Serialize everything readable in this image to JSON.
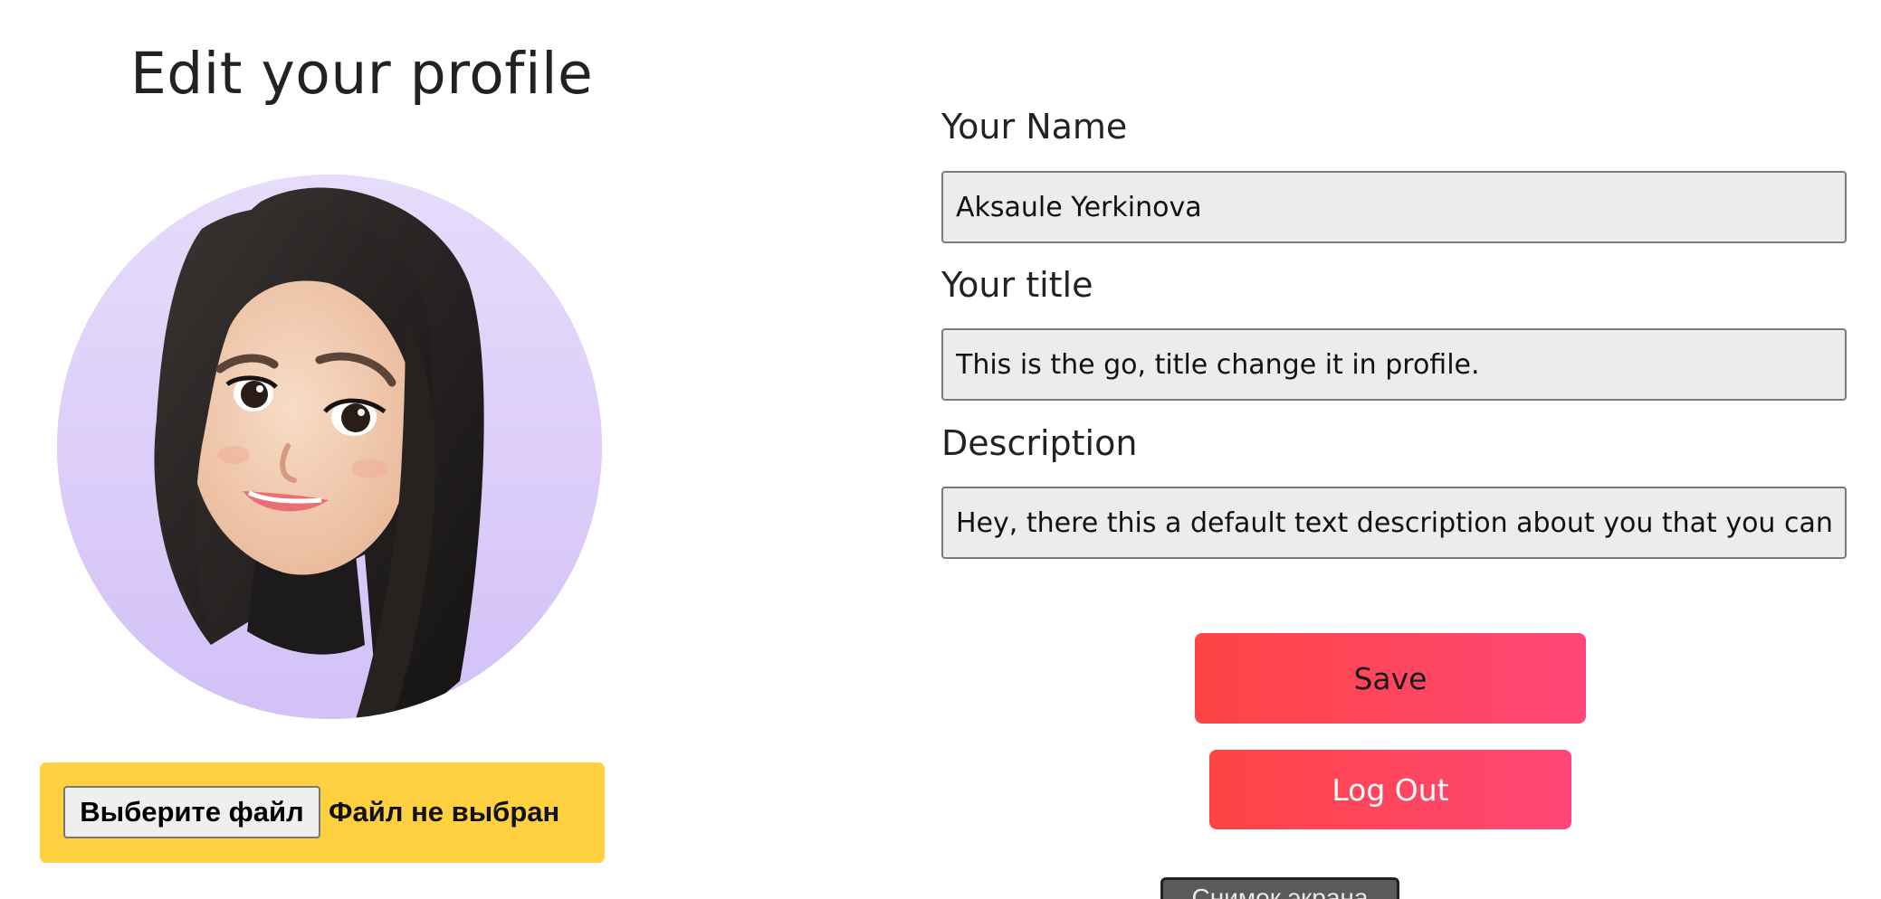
{
  "header": {
    "title": "Edit your profile"
  },
  "avatar": {
    "icon": "memoji-avatar",
    "background_color": "#d8c6f8"
  },
  "file_upload": {
    "button_label": "Выберите файл",
    "status_text": "Файл не выбран",
    "panel_color": "#ffd040"
  },
  "form": {
    "name": {
      "label": "Your Name",
      "value": "Aksaule Yerkinova"
    },
    "title": {
      "label": "Your title",
      "value": "This is the go, title change it in profile."
    },
    "description": {
      "label": "Description",
      "value": "Hey, there this a default text description about you that you can c"
    }
  },
  "actions": {
    "save_label": "Save",
    "logout_label": "Log Out",
    "accent_color_start": "#ff4444",
    "accent_color_end": "#ff4777"
  },
  "screenshot_button": {
    "label": "Снимок экрана"
  }
}
